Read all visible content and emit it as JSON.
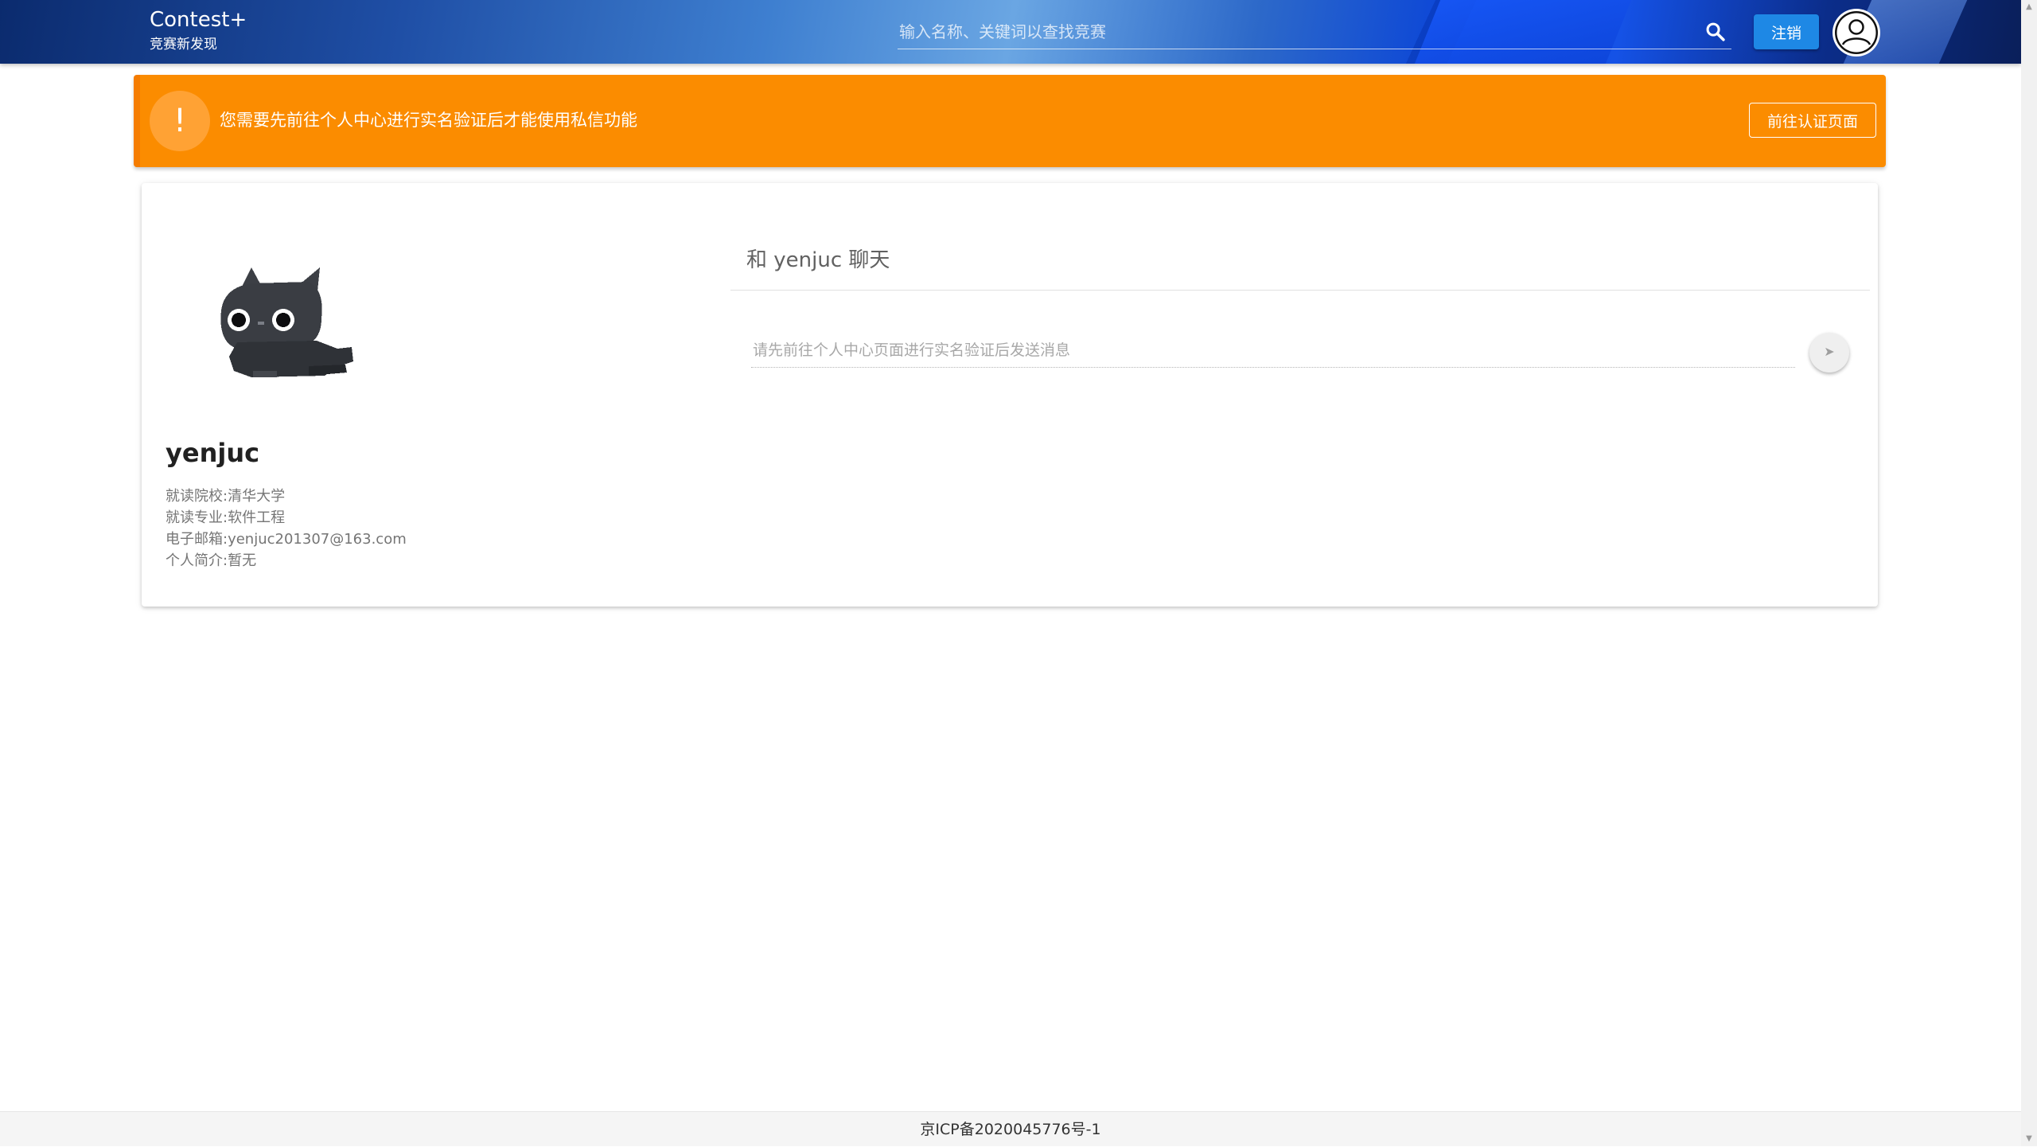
{
  "header": {
    "brand_title": "Contest+",
    "brand_subtitle": "竞赛新发现",
    "search_placeholder": "输入名称、关键词以查找竞赛",
    "search_icon": "search-icon",
    "logout_label": "注销",
    "avatar_icon": "account-circle-icon"
  },
  "alert": {
    "icon": "!",
    "message": "您需要先前往个人中心进行实名验证后才能使用私信功能",
    "button_label": "前往认证页面",
    "color": "#fb8c00"
  },
  "profile": {
    "name": "yenjuc",
    "info": [
      {
        "label": "就读院校:",
        "value": "清华大学"
      },
      {
        "label": "就读专业:",
        "value": "软件工程"
      },
      {
        "label": "电子邮箱:",
        "value": "yenjuc201307@163.com"
      },
      {
        "label": "个人简介:",
        "value": "暂无"
      }
    ]
  },
  "chat": {
    "title": "和 yenjuc 聊天",
    "input_placeholder": "请先前往个人中心页面进行实名验证后发送消息",
    "send_icon": "send-icon"
  },
  "footer": {
    "icp": "京ICP备2020045776号-1"
  },
  "colors": {
    "accent_blue": "#1e88e5",
    "warning_orange": "#fb8c00"
  }
}
